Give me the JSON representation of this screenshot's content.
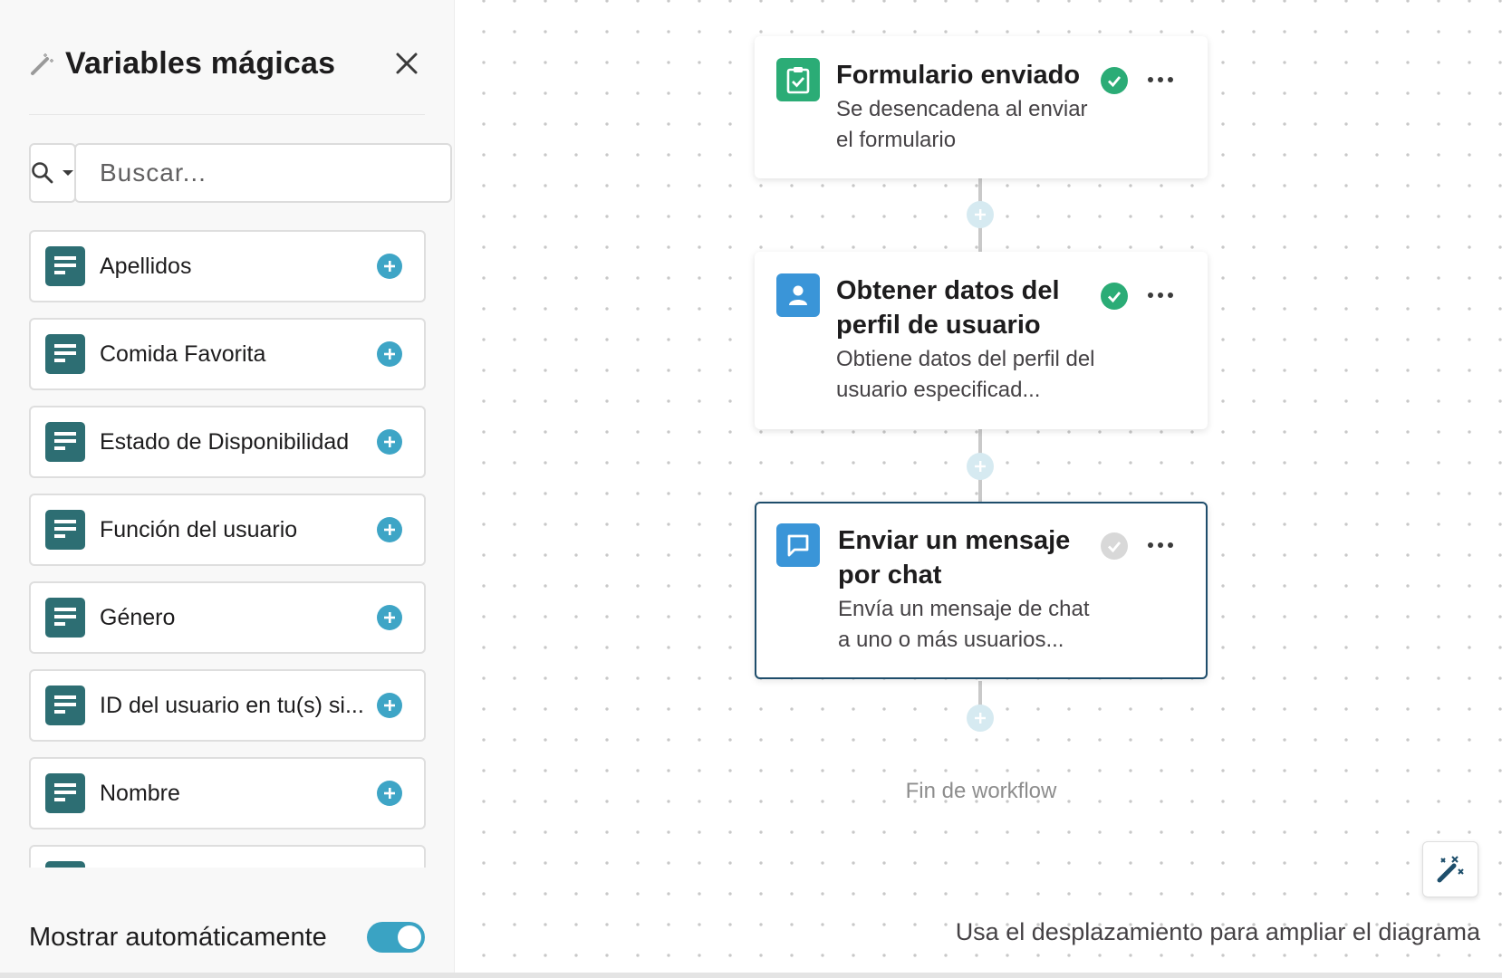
{
  "sidebar": {
    "title": "Variables mágicas",
    "title_icon": "magic-wand-icon",
    "close_icon": "close-icon",
    "search": {
      "filter_icon": "search-icon",
      "placeholder": "Buscar...",
      "value": ""
    },
    "items": [
      {
        "label": "Apellidos"
      },
      {
        "label": "Comida Favorita"
      },
      {
        "label": "Estado de Disponibilidad"
      },
      {
        "label": "Función del usuario"
      },
      {
        "label": "Género"
      },
      {
        "label": "ID del usuario en tu(s) si..."
      },
      {
        "label": "Nombre"
      },
      {
        "label": ""
      }
    ],
    "footer": {
      "auto_show_label": "Mostrar automáticamente",
      "auto_show_enabled": true
    }
  },
  "workflow": {
    "steps": [
      {
        "title": "Formulario enviado",
        "description": "Se desencadena al enviar el formulario",
        "icon": "form-check-icon",
        "icon_color": "#2bac76",
        "status": "complete"
      },
      {
        "title": "Obtener datos del perfil de usuario",
        "description": "Obtiene datos del perfil del usuario especificad...",
        "icon": "user-icon",
        "icon_color": "#3a95d8",
        "status": "complete"
      },
      {
        "title": "Enviar un mensaje por chat",
        "description": "Envía un mensaje de chat a uno o más usuarios...",
        "icon": "chat-bubble-icon",
        "icon_color": "#3a95d8",
        "status": "incomplete",
        "selected": true
      }
    ],
    "end_label": "Fin de workflow"
  },
  "canvas": {
    "zoom_hint": "Usa el desplazamiento para ampliar el diagrama",
    "magic_button_icon": "magic-wand-icon"
  },
  "colors": {
    "variable_icon_bg": "#2d6e73",
    "add_button": "#3ea5c6",
    "check_complete": "#2bac76",
    "check_incomplete": "#d8d8d8",
    "selected_border": "#1e4d6b"
  }
}
